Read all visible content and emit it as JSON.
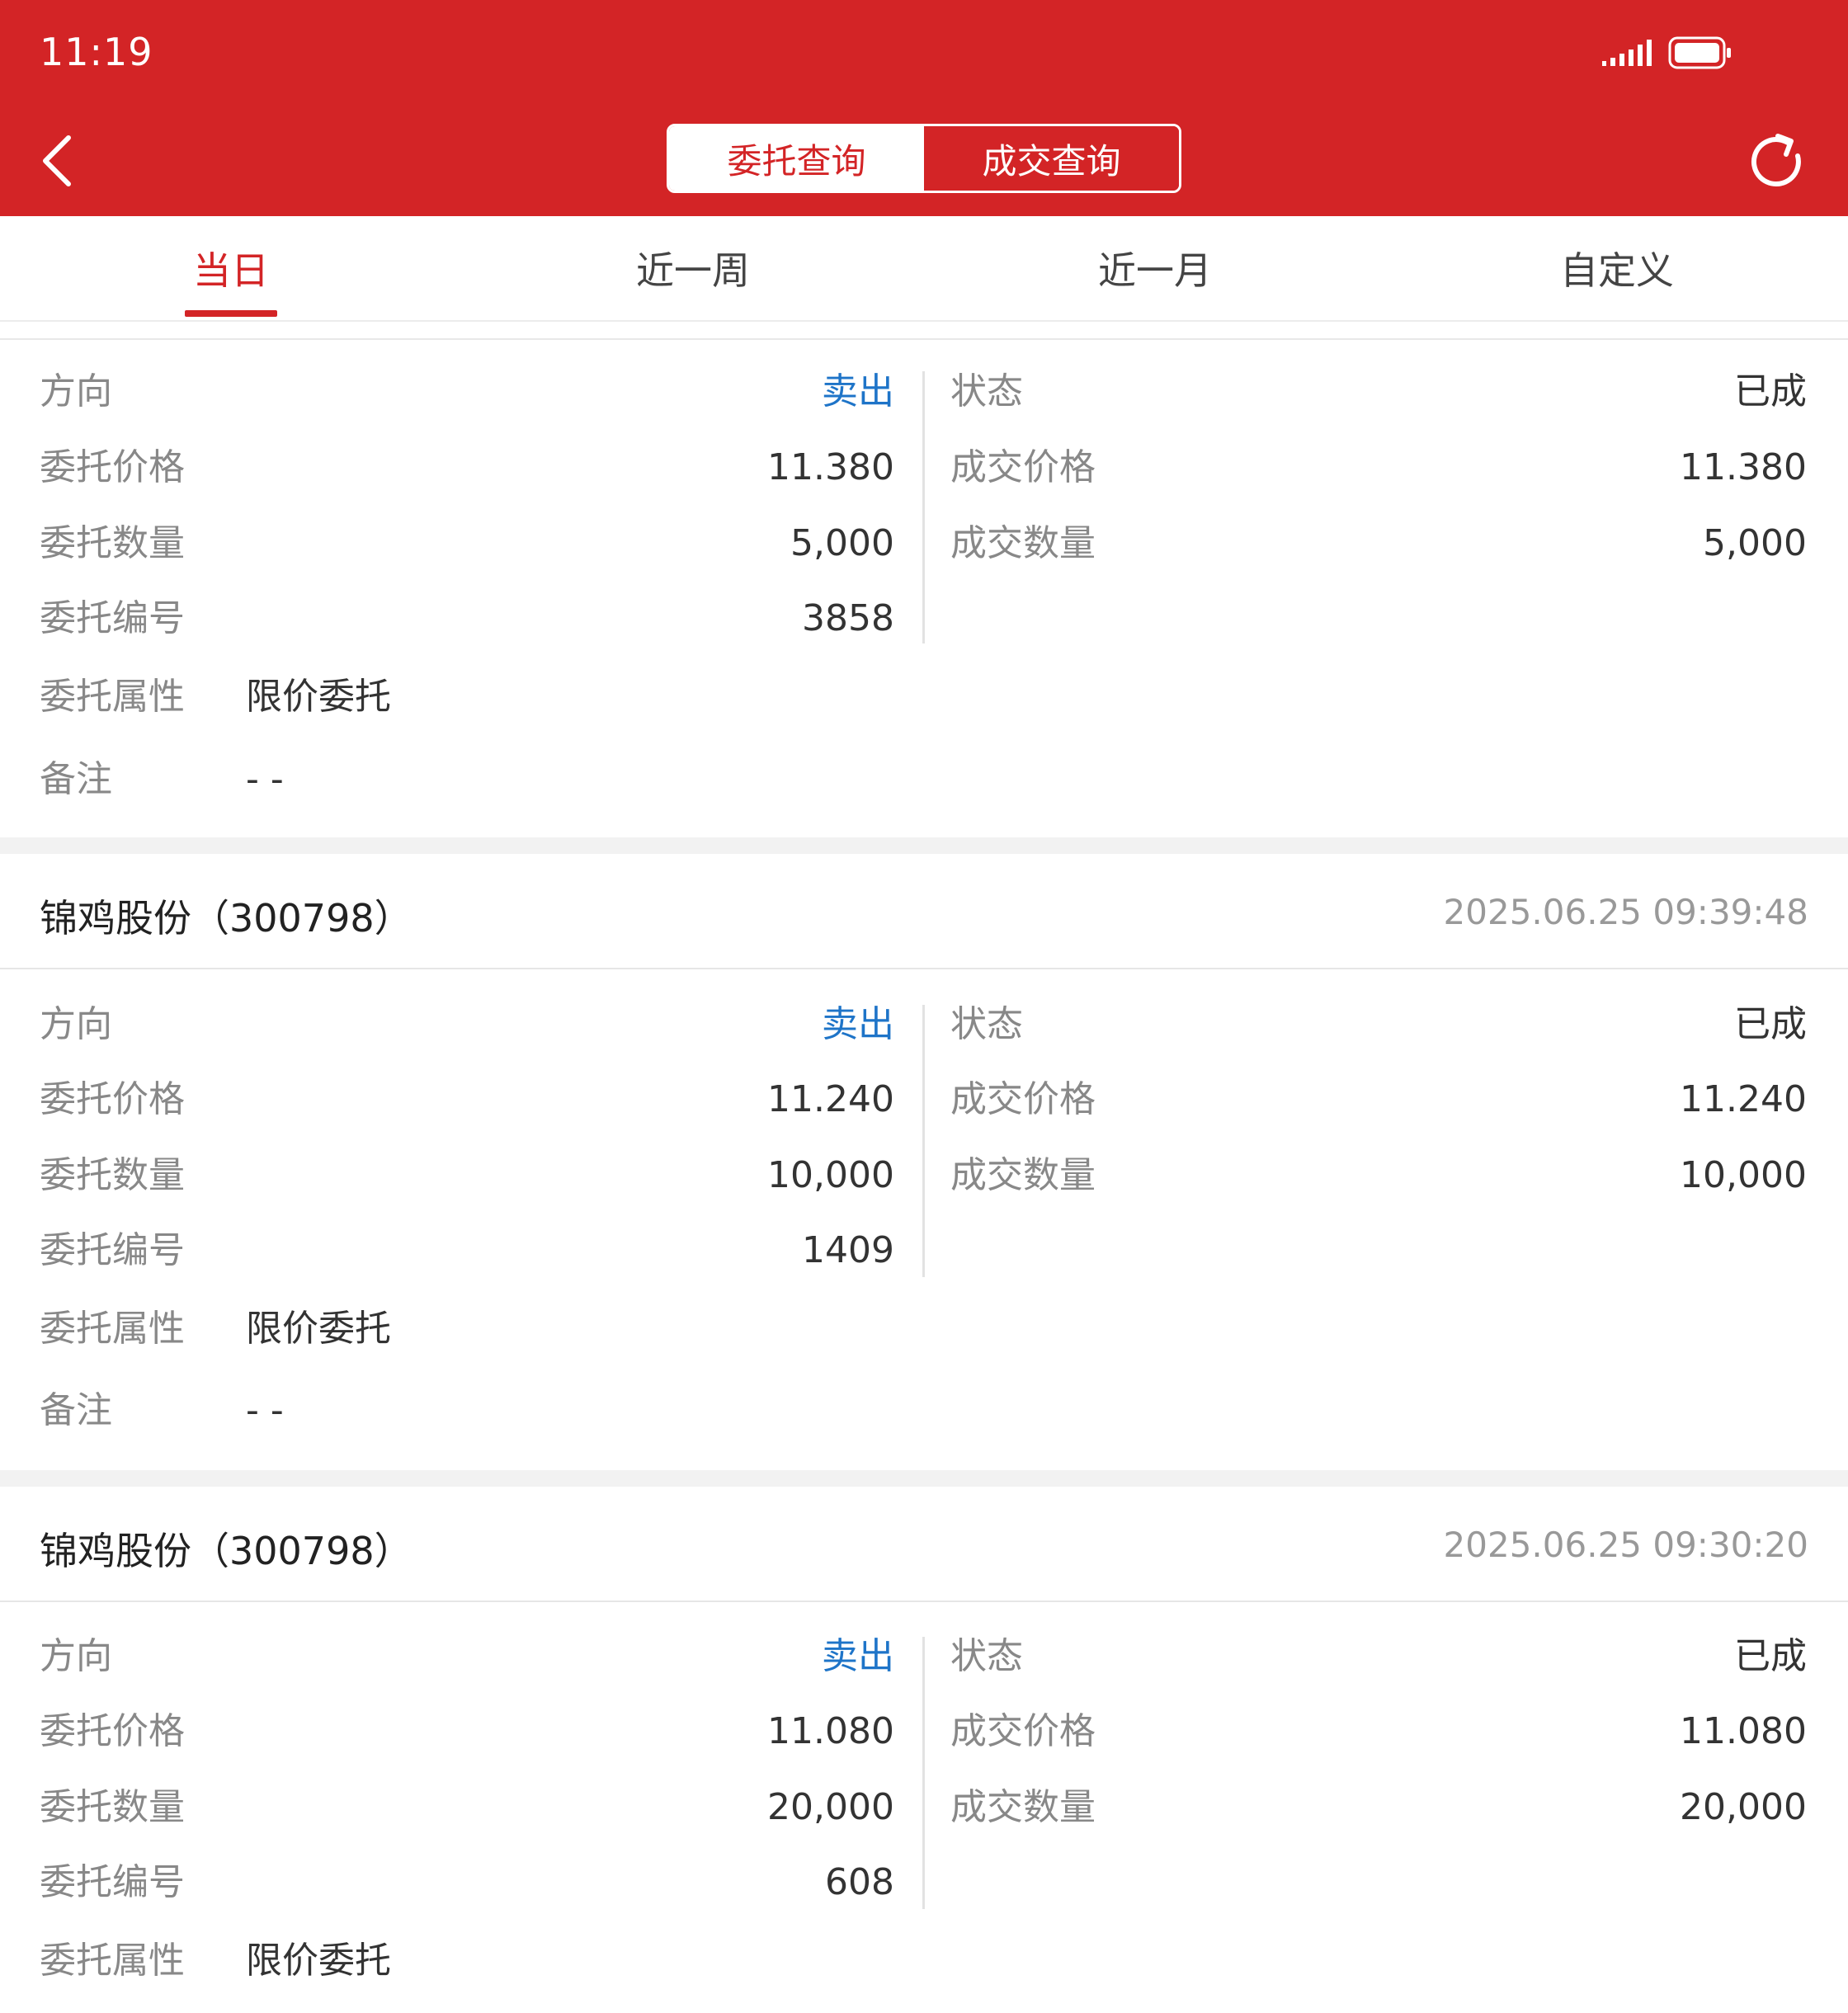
{
  "status_bar": {
    "time": "11:19"
  },
  "header": {
    "segments": [
      "委托查询",
      "成交查询"
    ],
    "active_segment": "委托查询"
  },
  "period_tabs": [
    "当日",
    "近一周",
    "近一月",
    "自定义"
  ],
  "active_period": "当日",
  "labels": {
    "direction": "方向",
    "status": "状态",
    "order_price": "委托价格",
    "deal_price": "成交价格",
    "order_qty": "委托数量",
    "deal_qty": "成交数量",
    "order_no": "委托编号",
    "order_attr": "委托属性",
    "remark": "备注"
  },
  "orders": [
    {
      "direction": "卖出",
      "status": "已成",
      "order_price": "11.380",
      "deal_price": "11.380",
      "order_qty": "5,000",
      "deal_qty": "5,000",
      "order_no": "3858",
      "order_attr": "限价委托",
      "remark": "- -"
    },
    {
      "stock": "锦鸡股份（300798）",
      "time": "2025.06.25 09:39:48",
      "direction": "卖出",
      "status": "已成",
      "order_price": "11.240",
      "deal_price": "11.240",
      "order_qty": "10,000",
      "deal_qty": "10,000",
      "order_no": "1409",
      "order_attr": "限价委托",
      "remark": "- -"
    },
    {
      "stock": "锦鸡股份（300798）",
      "time": "2025.06.25 09:30:20",
      "direction": "卖出",
      "status": "已成",
      "order_price": "11.080",
      "deal_price": "11.080",
      "order_qty": "20,000",
      "deal_qty": "20,000",
      "order_no": "608",
      "order_attr": "限价委托"
    }
  ],
  "colors": {
    "brand_red": "#d32426",
    "sell_blue": "#1e74c8",
    "label_gray": "#888888"
  },
  "icons": [
    "back-arrow-icon",
    "refresh-icon",
    "signal-icon",
    "battery-icon"
  ]
}
